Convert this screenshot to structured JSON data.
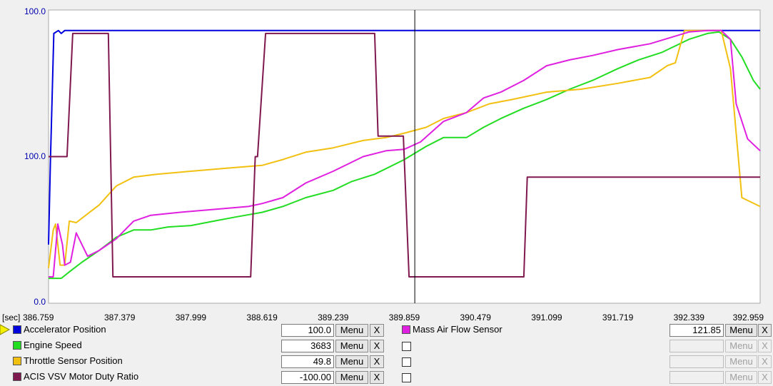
{
  "chart_data": {
    "type": "line",
    "x_unit": "[sec]",
    "x_ticks": [
      "386.759",
      "387.379",
      "387.999",
      "388.619",
      "389.239",
      "389.859",
      "390.479",
      "391.099",
      "391.719",
      "392.339",
      "392.959"
    ],
    "xlim": [
      386.759,
      392.959
    ],
    "y_tick_labels": [
      "100.0",
      "100.0",
      "0.0"
    ],
    "y_tick_color": "#0000b0",
    "cursor_x": 389.95,
    "grid": false,
    "series": [
      {
        "name": "Accelerator Position",
        "color": "#0000dd",
        "points": [
          [
            386.759,
            0.2
          ],
          [
            386.775,
            0.48
          ],
          [
            386.805,
            0.92
          ],
          [
            386.845,
            0.93
          ],
          [
            386.87,
            0.92
          ],
          [
            386.9,
            0.93
          ],
          [
            392.959,
            0.93
          ]
        ]
      },
      {
        "name": "Engine Speed",
        "color": "#22dd22",
        "points": [
          [
            386.759,
            0.085
          ],
          [
            386.8,
            0.085
          ],
          [
            386.87,
            0.085
          ],
          [
            386.95,
            0.11
          ],
          [
            387.05,
            0.14
          ],
          [
            387.2,
            0.18
          ],
          [
            387.35,
            0.225
          ],
          [
            387.5,
            0.25
          ],
          [
            387.65,
            0.25
          ],
          [
            387.8,
            0.26
          ],
          [
            388.0,
            0.265
          ],
          [
            388.2,
            0.28
          ],
          [
            388.4,
            0.295
          ],
          [
            388.619,
            0.31
          ],
          [
            388.8,
            0.33
          ],
          [
            389.0,
            0.36
          ],
          [
            389.239,
            0.385
          ],
          [
            389.4,
            0.415
          ],
          [
            389.6,
            0.44
          ],
          [
            389.859,
            0.49
          ],
          [
            390.05,
            0.535
          ],
          [
            390.2,
            0.565
          ],
          [
            390.4,
            0.565
          ],
          [
            390.55,
            0.6
          ],
          [
            390.7,
            0.63
          ],
          [
            390.9,
            0.665
          ],
          [
            391.099,
            0.695
          ],
          [
            391.3,
            0.73
          ],
          [
            391.5,
            0.76
          ],
          [
            391.719,
            0.8
          ],
          [
            391.9,
            0.83
          ],
          [
            392.1,
            0.855
          ],
          [
            392.339,
            0.9
          ],
          [
            392.5,
            0.92
          ],
          [
            392.6,
            0.925
          ],
          [
            392.7,
            0.9
          ],
          [
            392.8,
            0.84
          ],
          [
            392.9,
            0.76
          ],
          [
            392.959,
            0.73
          ]
        ]
      },
      {
        "name": "Throttle Sensor Position",
        "color": "#f2c010",
        "points": [
          [
            386.759,
            0.12
          ],
          [
            386.8,
            0.25
          ],
          [
            386.82,
            0.27
          ],
          [
            386.86,
            0.13
          ],
          [
            386.9,
            0.13
          ],
          [
            386.94,
            0.28
          ],
          [
            387.0,
            0.275
          ],
          [
            387.05,
            0.29
          ],
          [
            387.2,
            0.335
          ],
          [
            387.35,
            0.4
          ],
          [
            387.5,
            0.43
          ],
          [
            387.7,
            0.44
          ],
          [
            387.999,
            0.45
          ],
          [
            388.3,
            0.46
          ],
          [
            388.619,
            0.47
          ],
          [
            388.8,
            0.49
          ],
          [
            389.0,
            0.515
          ],
          [
            389.239,
            0.53
          ],
          [
            389.5,
            0.555
          ],
          [
            389.7,
            0.565
          ],
          [
            389.859,
            0.58
          ],
          [
            390.05,
            0.6
          ],
          [
            390.2,
            0.63
          ],
          [
            390.4,
            0.65
          ],
          [
            390.6,
            0.68
          ],
          [
            390.8,
            0.695
          ],
          [
            391.099,
            0.72
          ],
          [
            391.4,
            0.73
          ],
          [
            391.719,
            0.75
          ],
          [
            392.0,
            0.77
          ],
          [
            392.15,
            0.81
          ],
          [
            392.22,
            0.82
          ],
          [
            392.3,
            0.93
          ],
          [
            392.5,
            0.93
          ],
          [
            392.62,
            0.93
          ],
          [
            392.7,
            0.8
          ],
          [
            392.8,
            0.36
          ],
          [
            392.959,
            0.33
          ]
        ]
      },
      {
        "name": "Mass Air Flow Sensor",
        "color": "#e020e0",
        "points": [
          [
            386.759,
            0.09
          ],
          [
            386.8,
            0.09
          ],
          [
            386.84,
            0.27
          ],
          [
            386.88,
            0.2
          ],
          [
            386.9,
            0.13
          ],
          [
            386.95,
            0.14
          ],
          [
            387.0,
            0.24
          ],
          [
            387.1,
            0.16
          ],
          [
            387.2,
            0.18
          ],
          [
            387.35,
            0.22
          ],
          [
            387.5,
            0.28
          ],
          [
            387.65,
            0.3
          ],
          [
            387.9,
            0.31
          ],
          [
            388.2,
            0.32
          ],
          [
            388.5,
            0.33
          ],
          [
            388.619,
            0.34
          ],
          [
            388.8,
            0.36
          ],
          [
            389.0,
            0.41
          ],
          [
            389.239,
            0.45
          ],
          [
            389.5,
            0.5
          ],
          [
            389.7,
            0.52
          ],
          [
            389.859,
            0.525
          ],
          [
            390.0,
            0.55
          ],
          [
            390.2,
            0.62
          ],
          [
            390.4,
            0.65
          ],
          [
            390.55,
            0.7
          ],
          [
            390.7,
            0.72
          ],
          [
            390.9,
            0.76
          ],
          [
            391.099,
            0.81
          ],
          [
            391.3,
            0.83
          ],
          [
            391.5,
            0.845
          ],
          [
            391.719,
            0.865
          ],
          [
            392.0,
            0.885
          ],
          [
            392.339,
            0.925
          ],
          [
            392.5,
            0.93
          ],
          [
            392.62,
            0.93
          ],
          [
            392.7,
            0.9
          ],
          [
            392.75,
            0.68
          ],
          [
            392.85,
            0.56
          ],
          [
            392.959,
            0.52
          ]
        ]
      },
      {
        "name": "ACIS VSV Motor Duty Ratio",
        "color": "#801850",
        "points": [
          [
            386.759,
            0.5
          ],
          [
            386.92,
            0.5
          ],
          [
            386.97,
            0.92
          ],
          [
            387.28,
            0.92
          ],
          [
            387.32,
            0.09
          ],
          [
            388.52,
            0.09
          ],
          [
            388.56,
            0.5
          ],
          [
            388.58,
            0.5
          ],
          [
            388.65,
            0.92
          ],
          [
            389.6,
            0.92
          ],
          [
            389.63,
            0.57
          ],
          [
            389.85,
            0.57
          ],
          [
            389.9,
            0.09
          ],
          [
            390.9,
            0.09
          ],
          [
            390.93,
            0.43
          ],
          [
            392.959,
            0.43
          ]
        ]
      }
    ]
  },
  "panel": {
    "left": [
      {
        "name": "Accelerator Position",
        "color": "#0000dd",
        "value": "100.0",
        "menu": "Menu",
        "x": "X",
        "selected": true
      },
      {
        "name": "Engine Speed",
        "color": "#22dd22",
        "value": "3683",
        "menu": "Menu",
        "x": "X"
      },
      {
        "name": "Throttle Sensor Position",
        "color": "#f2c010",
        "value": "49.8",
        "menu": "Menu",
        "x": "X"
      },
      {
        "name": "ACIS VSV Motor Duty Ratio",
        "color": "#801850",
        "value": "-100.00",
        "menu": "Menu",
        "x": "X"
      }
    ],
    "right": [
      {
        "name": "Mass Air Flow Sensor",
        "color": "#e020e0",
        "value": "121.85",
        "menu": "Menu",
        "x": "X",
        "enabled": true
      },
      {
        "name": "",
        "value": "",
        "menu": "Menu",
        "x": "X",
        "enabled": false
      },
      {
        "name": "",
        "value": "",
        "menu": "Menu",
        "x": "X",
        "enabled": false
      },
      {
        "name": "",
        "value": "",
        "menu": "Menu",
        "x": "X",
        "enabled": false
      }
    ]
  }
}
